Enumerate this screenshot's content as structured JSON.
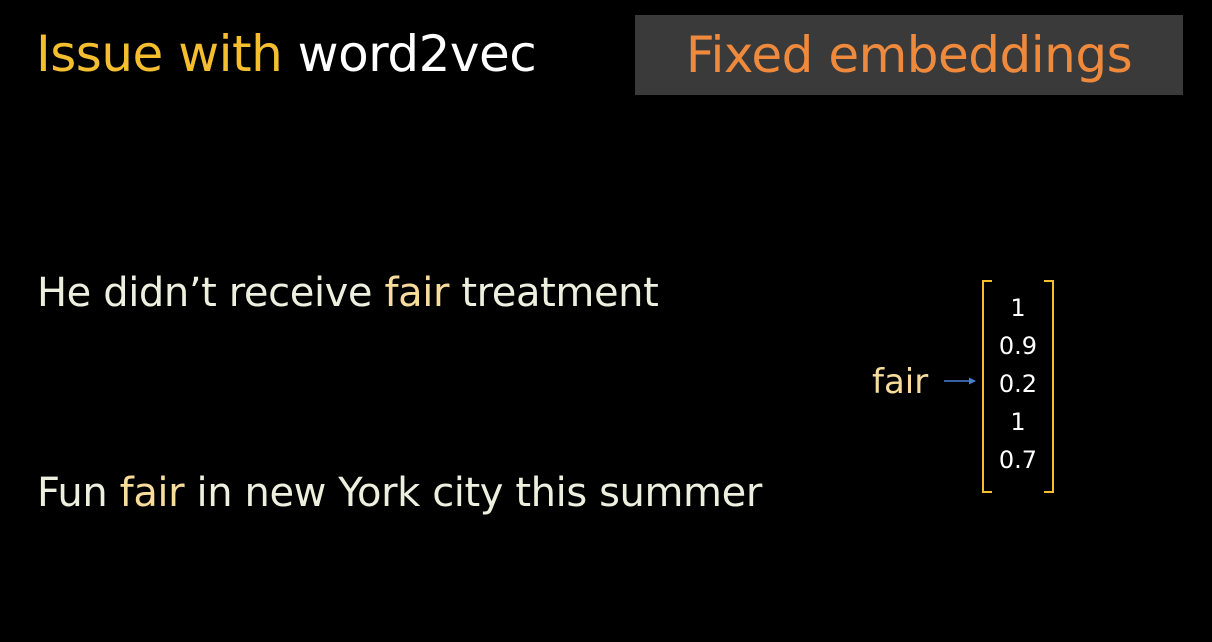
{
  "title": {
    "part1": "Issue with ",
    "part2": "word2vec"
  },
  "label_box": {
    "text": "Fixed embeddings"
  },
  "sentences": [
    {
      "before": "He didn’t receive ",
      "highlight": "fair",
      "after": " treatment"
    },
    {
      "before": "Fun ",
      "highlight": "fair",
      "after": " in new York city this summer"
    }
  ],
  "vector": {
    "word": "fair",
    "values": [
      "1",
      "0.9",
      "0.2",
      "1",
      "0.7"
    ]
  },
  "colors": {
    "background": "#000000",
    "title_highlight": "#f5be2e",
    "title_plain": "#ffffff",
    "label_box_bg": "#3a3a3a",
    "label_box_text": "#ef8a3d",
    "sentence_text": "#eef0df",
    "word_highlight": "#f8dc9c",
    "bracket": "#f5be2e",
    "arrow": "#4a7fd4"
  }
}
